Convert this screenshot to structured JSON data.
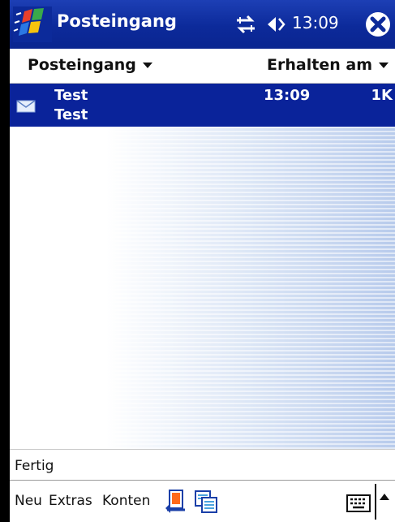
{
  "titlebar": {
    "title": "Posteingang",
    "clock": "13:09",
    "icons": [
      "windows-start-icon",
      "connectivity-icon",
      "volume-icon",
      "close-icon"
    ]
  },
  "header": {
    "folder": "Posteingang",
    "sort": "Erhalten am"
  },
  "messages": [
    {
      "from": "Test",
      "subject": "Test",
      "time": "13:09",
      "size": "1K",
      "icon": "envelope-icon",
      "selected": true
    }
  ],
  "status": {
    "text": "Fertig"
  },
  "commandbar": {
    "items": [
      "Neu",
      "Extras",
      "Konten"
    ],
    "icons": [
      "send-receive-icon",
      "folder-list-icon",
      "keyboard-icon",
      "sip-arrow-icon"
    ]
  },
  "colors": {
    "title_bg": "#0c2a9a",
    "selection_bg": "#0a239a",
    "text": "#111111"
  }
}
